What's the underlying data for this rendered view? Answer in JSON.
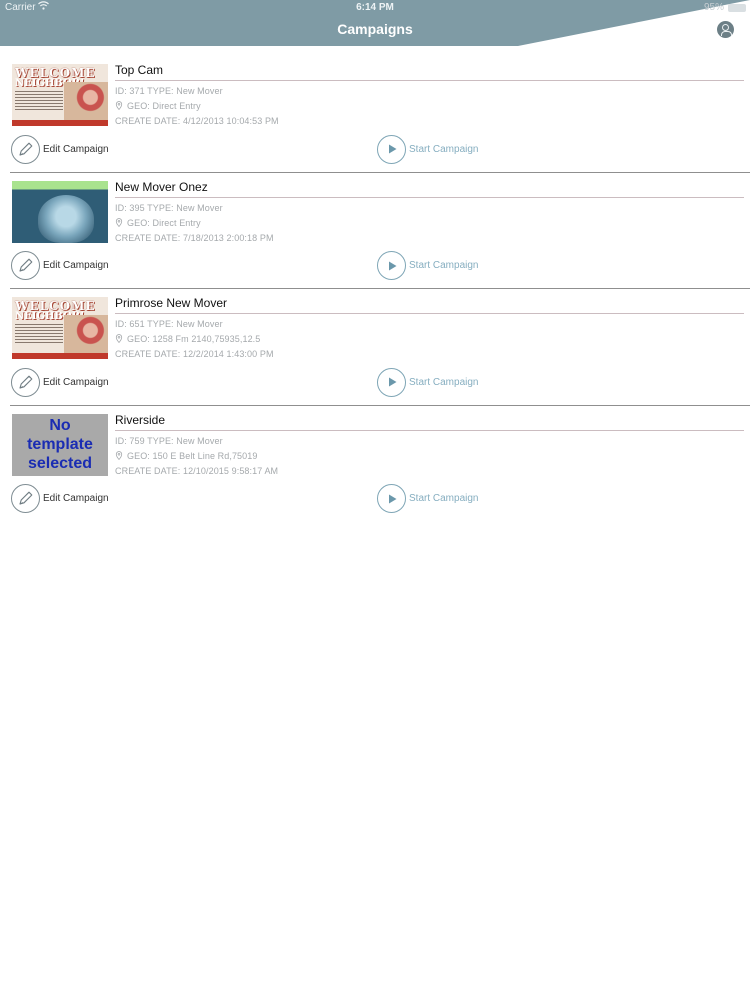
{
  "status_bar": {
    "carrier": "Carrier",
    "time": "6:14 PM",
    "battery": "95%"
  },
  "nav": {
    "title": "Campaigns",
    "profile_icon": "user-circle-icon"
  },
  "colors": {
    "header": "#7f9ba5",
    "accent": "#86aec0",
    "no_template_text": "#1a2cb3"
  },
  "campaigns": [
    {
      "name": "Top Cam",
      "id_type": "ID: 371 TYPE:  New Mover",
      "geo": "GEO:  Direct Entry",
      "create_date": "CREATE DATE:  4/12/2013 10:04:53 PM",
      "thumbnail": "welcome",
      "thumb_text_1": "WELCOME",
      "thumb_text_2": "NEIGHBOR!",
      "edit_label": "Edit Campaign",
      "start_label": "Start Campaign"
    },
    {
      "name": "New Mover Onez",
      "id_type": "ID: 395 TYPE:  New Mover",
      "geo": "GEO:  Direct Entry",
      "create_date": "CREATE DATE:  7/18/2013 2:00:18 PM",
      "thumbnail": "baby-photo",
      "edit_label": "Edit Campaign",
      "start_label": "Start Campaign"
    },
    {
      "name": "Primrose New Mover",
      "id_type": "ID: 651 TYPE:  New Mover",
      "geo": "GEO:  1258 Fm 2140,75935,12.5",
      "create_date": "CREATE DATE:  12/2/2014 1:43:00 PM",
      "thumbnail": "welcome",
      "thumb_text_1": "WELCOME",
      "thumb_text_2": "NEIGHBOR!",
      "edit_label": "Edit Campaign",
      "start_label": "Start Campaign"
    },
    {
      "name": "Riverside",
      "id_type": "ID: 759 TYPE:  New Mover",
      "geo": "GEO:  150 E Belt Line Rd,75019",
      "create_date": "CREATE DATE:  12/10/2015 9:58:17 AM",
      "thumbnail": "no-template",
      "thumb_text_1": "No",
      "thumb_text_2": "template",
      "thumb_text_3": "selected",
      "edit_label": "Edit Campaign",
      "start_label": "Start Campaign"
    }
  ]
}
